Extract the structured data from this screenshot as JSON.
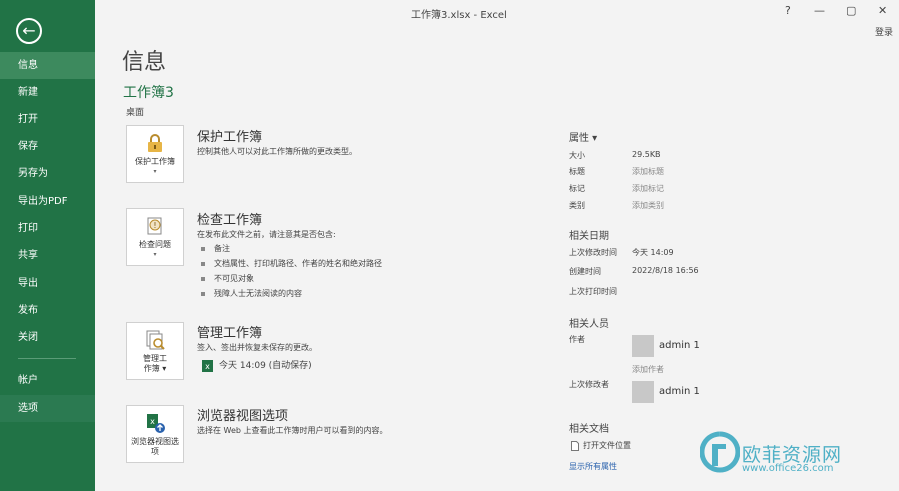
{
  "window": {
    "title": "工作簿3.xlsx - Excel",
    "help": "?",
    "minimize": "—",
    "restore": "▢",
    "close": "✕",
    "login": "登录"
  },
  "sidebar": {
    "back_icon": "arrow-left-icon",
    "items": [
      {
        "label": "信息"
      },
      {
        "label": "新建"
      },
      {
        "label": "打开"
      },
      {
        "label": "保存"
      },
      {
        "label": "另存为"
      },
      {
        "label": "导出为PDF"
      },
      {
        "label": "打印"
      },
      {
        "label": "共享"
      },
      {
        "label": "导出"
      },
      {
        "label": "发布"
      },
      {
        "label": "关闭"
      },
      {
        "label": "帐户"
      },
      {
        "label": "选项"
      }
    ],
    "active_index": 0,
    "hover_index": 12
  },
  "main": {
    "heading": "信息",
    "doc_name": "工作簿3",
    "doc_location": "桌面",
    "sections": {
      "protect": {
        "tile_label": "保护工作簿",
        "tile_caret": "▾",
        "title": "保护工作簿",
        "desc": "控制其他人可以对此工作簿所做的更改类型。"
      },
      "inspect": {
        "tile_label": "检查问题",
        "tile_caret": "▾",
        "title": "检查工作簿",
        "desc": "在发布此文件之前，请注意其是否包含:",
        "bullets": [
          "备注",
          "文档属性、打印机路径、作者的姓名和绝对路径",
          "不可见对象",
          "残障人士无法阅读的内容"
        ]
      },
      "manage": {
        "tile_label": "管理工\n作簿 ▾",
        "title": "管理工作簿",
        "desc": "签入、签出并恢复未保存的更改。",
        "version": "今天 14:09 (自动保存)"
      },
      "browser": {
        "tile_label": "浏览器视图选项",
        "title": "浏览器视图选项",
        "desc": "选择在 Web 上查看此工作簿时用户可以看到的内容。"
      }
    }
  },
  "properties": {
    "header": "属性 ▾",
    "rows": [
      {
        "key": "大小",
        "value": "29.5KB",
        "link": false
      },
      {
        "key": "标题",
        "value": "添加标题",
        "link": true
      },
      {
        "key": "标记",
        "value": "添加标记",
        "link": true
      },
      {
        "key": "类别",
        "value": "添加类别",
        "link": true
      }
    ],
    "dates_header": "相关日期",
    "dates": [
      {
        "key": "上次修改时间",
        "value": "今天 14:09"
      },
      {
        "key": "创建时间",
        "value": "2022/8/18 16:56"
      },
      {
        "key": "上次打印时间",
        "value": ""
      }
    ],
    "people_header": "相关人员",
    "author_key": "作者",
    "author_name": "admin 1",
    "add_author": "添加作者",
    "modifier_key": "上次修改者",
    "modifier_name": "admin 1",
    "docs_header": "相关文档",
    "open_location": "打开文件位置",
    "show_all": "显示所有属性"
  },
  "watermark": {
    "text": "欧菲资源网",
    "url": "www.office26.com"
  },
  "colors": {
    "accent": "#217346",
    "link": "#2a62ad",
    "watermark": "#4fb0c6"
  }
}
